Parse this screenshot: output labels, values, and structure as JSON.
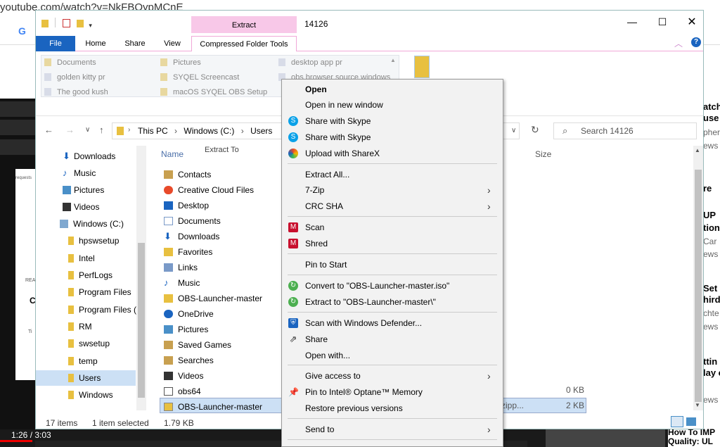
{
  "browser": {
    "url": "youtube.com/watch?v=NkFBOypMCnE",
    "right_texts": [
      "atch",
      "use",
      "pher",
      "ews",
      "re",
      "UP",
      "tion",
      "Car",
      "ews",
      "Set",
      "hird",
      "chte",
      "ews",
      "ttin",
      "lay c",
      "ews"
    ],
    "video_time": "1:26 / 3:03",
    "bottom_right": "How To IMP Quality: UL",
    "left_texts": [
      "requests",
      "REA",
      "C",
      "Ti"
    ]
  },
  "window": {
    "title": "14126",
    "contextual_group": "Extract",
    "tabs": [
      "File",
      "Home",
      "Share",
      "View",
      "Compressed Folder Tools"
    ],
    "help": "?",
    "ribbon": {
      "col1": [
        "Documents",
        "golden kitty pr",
        "The good kush"
      ],
      "col2": [
        "Pictures",
        "SYQEL Screencast",
        "macOS SYQEL OBS Setup"
      ],
      "col3": [
        "desktop app pr",
        "obs browser source windows"
      ],
      "group_label": "Extract To"
    },
    "address": [
      "This PC",
      "Windows (C:)",
      "Users"
    ],
    "search_placeholder": "Search 14126",
    "nav_pane": [
      "Downloads",
      "Music",
      "Pictures",
      "Videos",
      "Windows (C:)",
      "hpswsetup",
      "Intel",
      "PerfLogs",
      "Program Files",
      "Program Files (",
      "RM",
      "swsetup",
      "temp",
      "Users",
      "Windows"
    ],
    "column_name": "Name",
    "column_size": "Size",
    "files": [
      "Contacts",
      "Creative Cloud Files",
      "Desktop",
      "Documents",
      "Downloads",
      "Favorites",
      "Links",
      "Music",
      "OBS-Launcher-master",
      "OneDrive",
      "Pictures",
      "Saved Games",
      "Searches",
      "Videos",
      "obs64",
      "OBS-Launcher-master"
    ],
    "sizes": {
      "obs64": "0 KB",
      "zip": "2 KB",
      "zip_type": "zipp..."
    },
    "status_items": "17 items",
    "status_selected": "1 item selected",
    "status_size": "1.79 KB"
  },
  "menu": {
    "items": [
      {
        "label": "Open",
        "bold": true
      },
      {
        "label": "Open in new window"
      },
      {
        "label": "Share with Skype",
        "icon": "skype-icon",
        "color": "#0aa1e8"
      },
      {
        "label": "Share with Skype",
        "icon": "skype-icon",
        "color": "#0aa1e8"
      },
      {
        "label": "Upload with ShareX",
        "icon": "sharex-icon",
        "color": "#e84a2a"
      },
      {
        "label": "Extract All..."
      },
      {
        "label": "7-Zip",
        "submenu": true
      },
      {
        "label": "CRC SHA",
        "submenu": true
      },
      {
        "label": "Scan",
        "icon": "mcafee-icon",
        "color": "#c8102e"
      },
      {
        "label": "Shred",
        "icon": "mcafee-icon",
        "color": "#c8102e"
      },
      {
        "label": "Pin to Start"
      },
      {
        "label": "Convert to \"OBS-Launcher-master.iso\"",
        "icon": "convert-icon",
        "color": "#4caf50"
      },
      {
        "label": "Extract to \"OBS-Launcher-master\\\"",
        "icon": "extract-icon",
        "color": "#4caf50"
      },
      {
        "label": "Scan with Windows Defender...",
        "icon": "defender-icon",
        "color": "#1a64c0"
      },
      {
        "label": "Share",
        "icon": "share-icon",
        "color": "#555"
      },
      {
        "label": "Open with..."
      },
      {
        "label": "Give access to",
        "submenu": true
      },
      {
        "label": "Pin to Intel® Optane™ Memory",
        "icon": "pin-icon",
        "color": "#1a64c0"
      },
      {
        "label": "Restore previous versions"
      },
      {
        "label": "Send to",
        "submenu": true
      }
    ]
  }
}
